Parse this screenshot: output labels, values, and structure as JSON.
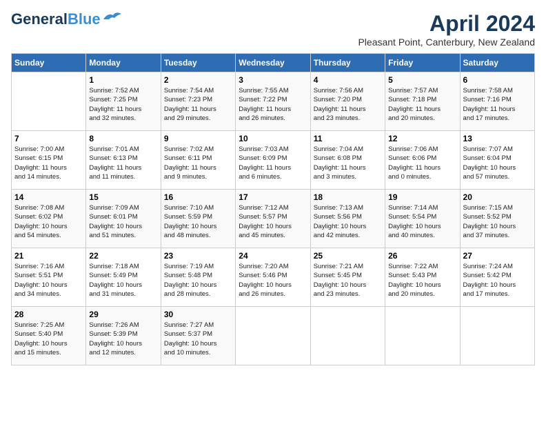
{
  "header": {
    "logo_line1": "General",
    "logo_line2": "Blue",
    "month": "April 2024",
    "location": "Pleasant Point, Canterbury, New Zealand"
  },
  "weekdays": [
    "Sunday",
    "Monday",
    "Tuesday",
    "Wednesday",
    "Thursday",
    "Friday",
    "Saturday"
  ],
  "weeks": [
    [
      {
        "day": "",
        "info": ""
      },
      {
        "day": "1",
        "info": "Sunrise: 7:52 AM\nSunset: 7:25 PM\nDaylight: 11 hours\nand 32 minutes."
      },
      {
        "day": "2",
        "info": "Sunrise: 7:54 AM\nSunset: 7:23 PM\nDaylight: 11 hours\nand 29 minutes."
      },
      {
        "day": "3",
        "info": "Sunrise: 7:55 AM\nSunset: 7:22 PM\nDaylight: 11 hours\nand 26 minutes."
      },
      {
        "day": "4",
        "info": "Sunrise: 7:56 AM\nSunset: 7:20 PM\nDaylight: 11 hours\nand 23 minutes."
      },
      {
        "day": "5",
        "info": "Sunrise: 7:57 AM\nSunset: 7:18 PM\nDaylight: 11 hours\nand 20 minutes."
      },
      {
        "day": "6",
        "info": "Sunrise: 7:58 AM\nSunset: 7:16 PM\nDaylight: 11 hours\nand 17 minutes."
      }
    ],
    [
      {
        "day": "7",
        "info": "Sunrise: 7:00 AM\nSunset: 6:15 PM\nDaylight: 11 hours\nand 14 minutes."
      },
      {
        "day": "8",
        "info": "Sunrise: 7:01 AM\nSunset: 6:13 PM\nDaylight: 11 hours\nand 11 minutes."
      },
      {
        "day": "9",
        "info": "Sunrise: 7:02 AM\nSunset: 6:11 PM\nDaylight: 11 hours\nand 9 minutes."
      },
      {
        "day": "10",
        "info": "Sunrise: 7:03 AM\nSunset: 6:09 PM\nDaylight: 11 hours\nand 6 minutes."
      },
      {
        "day": "11",
        "info": "Sunrise: 7:04 AM\nSunset: 6:08 PM\nDaylight: 11 hours\nand 3 minutes."
      },
      {
        "day": "12",
        "info": "Sunrise: 7:06 AM\nSunset: 6:06 PM\nDaylight: 11 hours\nand 0 minutes."
      },
      {
        "day": "13",
        "info": "Sunrise: 7:07 AM\nSunset: 6:04 PM\nDaylight: 10 hours\nand 57 minutes."
      }
    ],
    [
      {
        "day": "14",
        "info": "Sunrise: 7:08 AM\nSunset: 6:02 PM\nDaylight: 10 hours\nand 54 minutes."
      },
      {
        "day": "15",
        "info": "Sunrise: 7:09 AM\nSunset: 6:01 PM\nDaylight: 10 hours\nand 51 minutes."
      },
      {
        "day": "16",
        "info": "Sunrise: 7:10 AM\nSunset: 5:59 PM\nDaylight: 10 hours\nand 48 minutes."
      },
      {
        "day": "17",
        "info": "Sunrise: 7:12 AM\nSunset: 5:57 PM\nDaylight: 10 hours\nand 45 minutes."
      },
      {
        "day": "18",
        "info": "Sunrise: 7:13 AM\nSunset: 5:56 PM\nDaylight: 10 hours\nand 42 minutes."
      },
      {
        "day": "19",
        "info": "Sunrise: 7:14 AM\nSunset: 5:54 PM\nDaylight: 10 hours\nand 40 minutes."
      },
      {
        "day": "20",
        "info": "Sunrise: 7:15 AM\nSunset: 5:52 PM\nDaylight: 10 hours\nand 37 minutes."
      }
    ],
    [
      {
        "day": "21",
        "info": "Sunrise: 7:16 AM\nSunset: 5:51 PM\nDaylight: 10 hours\nand 34 minutes."
      },
      {
        "day": "22",
        "info": "Sunrise: 7:18 AM\nSunset: 5:49 PM\nDaylight: 10 hours\nand 31 minutes."
      },
      {
        "day": "23",
        "info": "Sunrise: 7:19 AM\nSunset: 5:48 PM\nDaylight: 10 hours\nand 28 minutes."
      },
      {
        "day": "24",
        "info": "Sunrise: 7:20 AM\nSunset: 5:46 PM\nDaylight: 10 hours\nand 26 minutes."
      },
      {
        "day": "25",
        "info": "Sunrise: 7:21 AM\nSunset: 5:45 PM\nDaylight: 10 hours\nand 23 minutes."
      },
      {
        "day": "26",
        "info": "Sunrise: 7:22 AM\nSunset: 5:43 PM\nDaylight: 10 hours\nand 20 minutes."
      },
      {
        "day": "27",
        "info": "Sunrise: 7:24 AM\nSunset: 5:42 PM\nDaylight: 10 hours\nand 17 minutes."
      }
    ],
    [
      {
        "day": "28",
        "info": "Sunrise: 7:25 AM\nSunset: 5:40 PM\nDaylight: 10 hours\nand 15 minutes."
      },
      {
        "day": "29",
        "info": "Sunrise: 7:26 AM\nSunset: 5:39 PM\nDaylight: 10 hours\nand 12 minutes."
      },
      {
        "day": "30",
        "info": "Sunrise: 7:27 AM\nSunset: 5:37 PM\nDaylight: 10 hours\nand 10 minutes."
      },
      {
        "day": "",
        "info": ""
      },
      {
        "day": "",
        "info": ""
      },
      {
        "day": "",
        "info": ""
      },
      {
        "day": "",
        "info": ""
      }
    ]
  ]
}
